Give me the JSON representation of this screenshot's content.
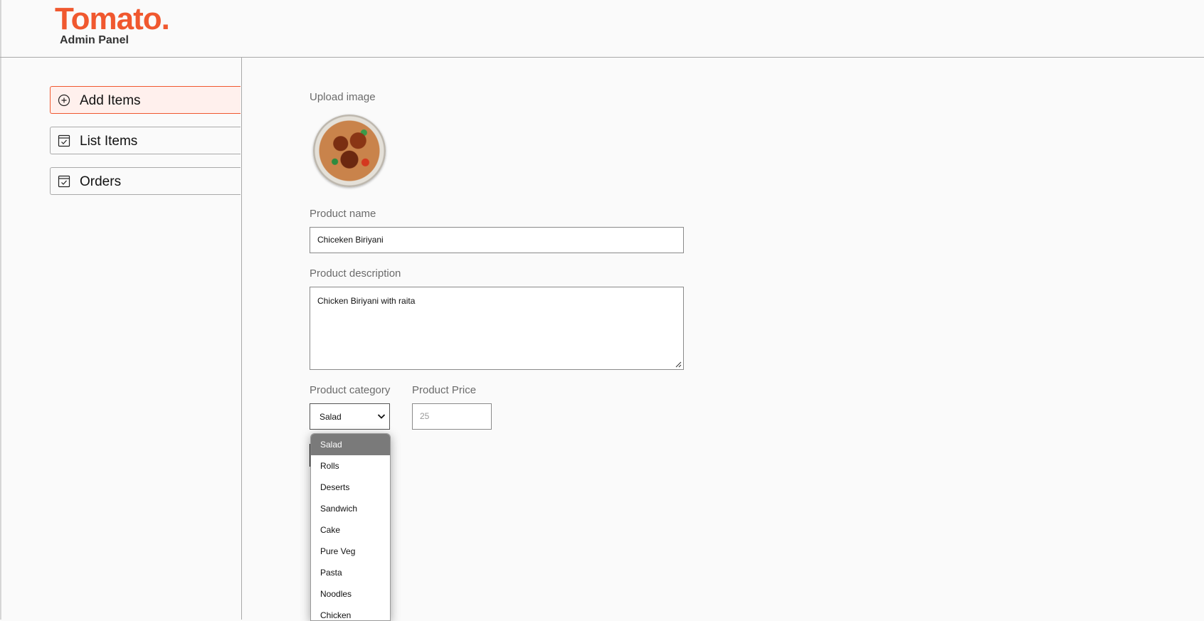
{
  "header": {
    "logo": "Tomato.",
    "subtitle": "Admin Panel"
  },
  "sidebar": {
    "items": [
      {
        "label": "Add Items",
        "icon": "add-circle-icon",
        "active": true
      },
      {
        "label": "List Items",
        "icon": "checklist-icon",
        "active": false
      },
      {
        "label": "Orders",
        "icon": "checklist-icon",
        "active": false
      }
    ]
  },
  "form": {
    "upload_label": "Upload image",
    "upload_image": "chicken-biriyani-thumbnail",
    "name_label": "Product name",
    "name_value": "Chiceken  Biriyani",
    "description_label": "Product description",
    "description_value": "Chicken Biriyani with raita",
    "category_label": "Product category",
    "category_value": "Salad",
    "price_label": "Product Price",
    "price_placeholder": "25"
  },
  "dropdown": {
    "options": [
      "Salad",
      "Rolls",
      "Deserts",
      "Sandwich",
      "Cake",
      "Pure Veg",
      "Pasta",
      "Noodles",
      "Chicken"
    ],
    "selected": "Salad"
  },
  "colors": {
    "brand": "#f0582f",
    "active_bg": "#fff0ed"
  }
}
